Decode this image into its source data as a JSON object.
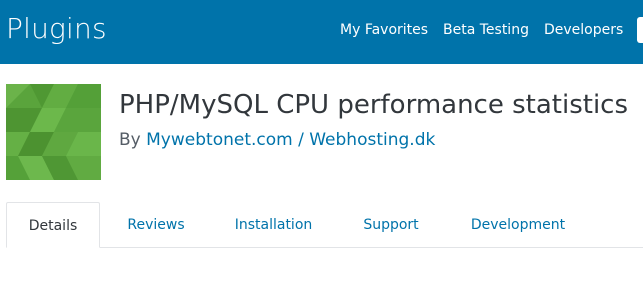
{
  "header": {
    "title": "Plugins",
    "nav": [
      "My Favorites",
      "Beta Testing",
      "Developers"
    ]
  },
  "plugin": {
    "name": "PHP/MySQL CPU performance statistics",
    "by_prefix": "By",
    "author": "Mywebtonet.com / Webhosting.dk",
    "banner_icon": "plugin-banner-icon"
  },
  "tabs": [
    "Details",
    "Reviews",
    "Installation",
    "Support",
    "Development"
  ],
  "colors": {
    "header_bg": "#0073aa",
    "link": "#0073aa",
    "banner_green": "#5aa43c"
  }
}
